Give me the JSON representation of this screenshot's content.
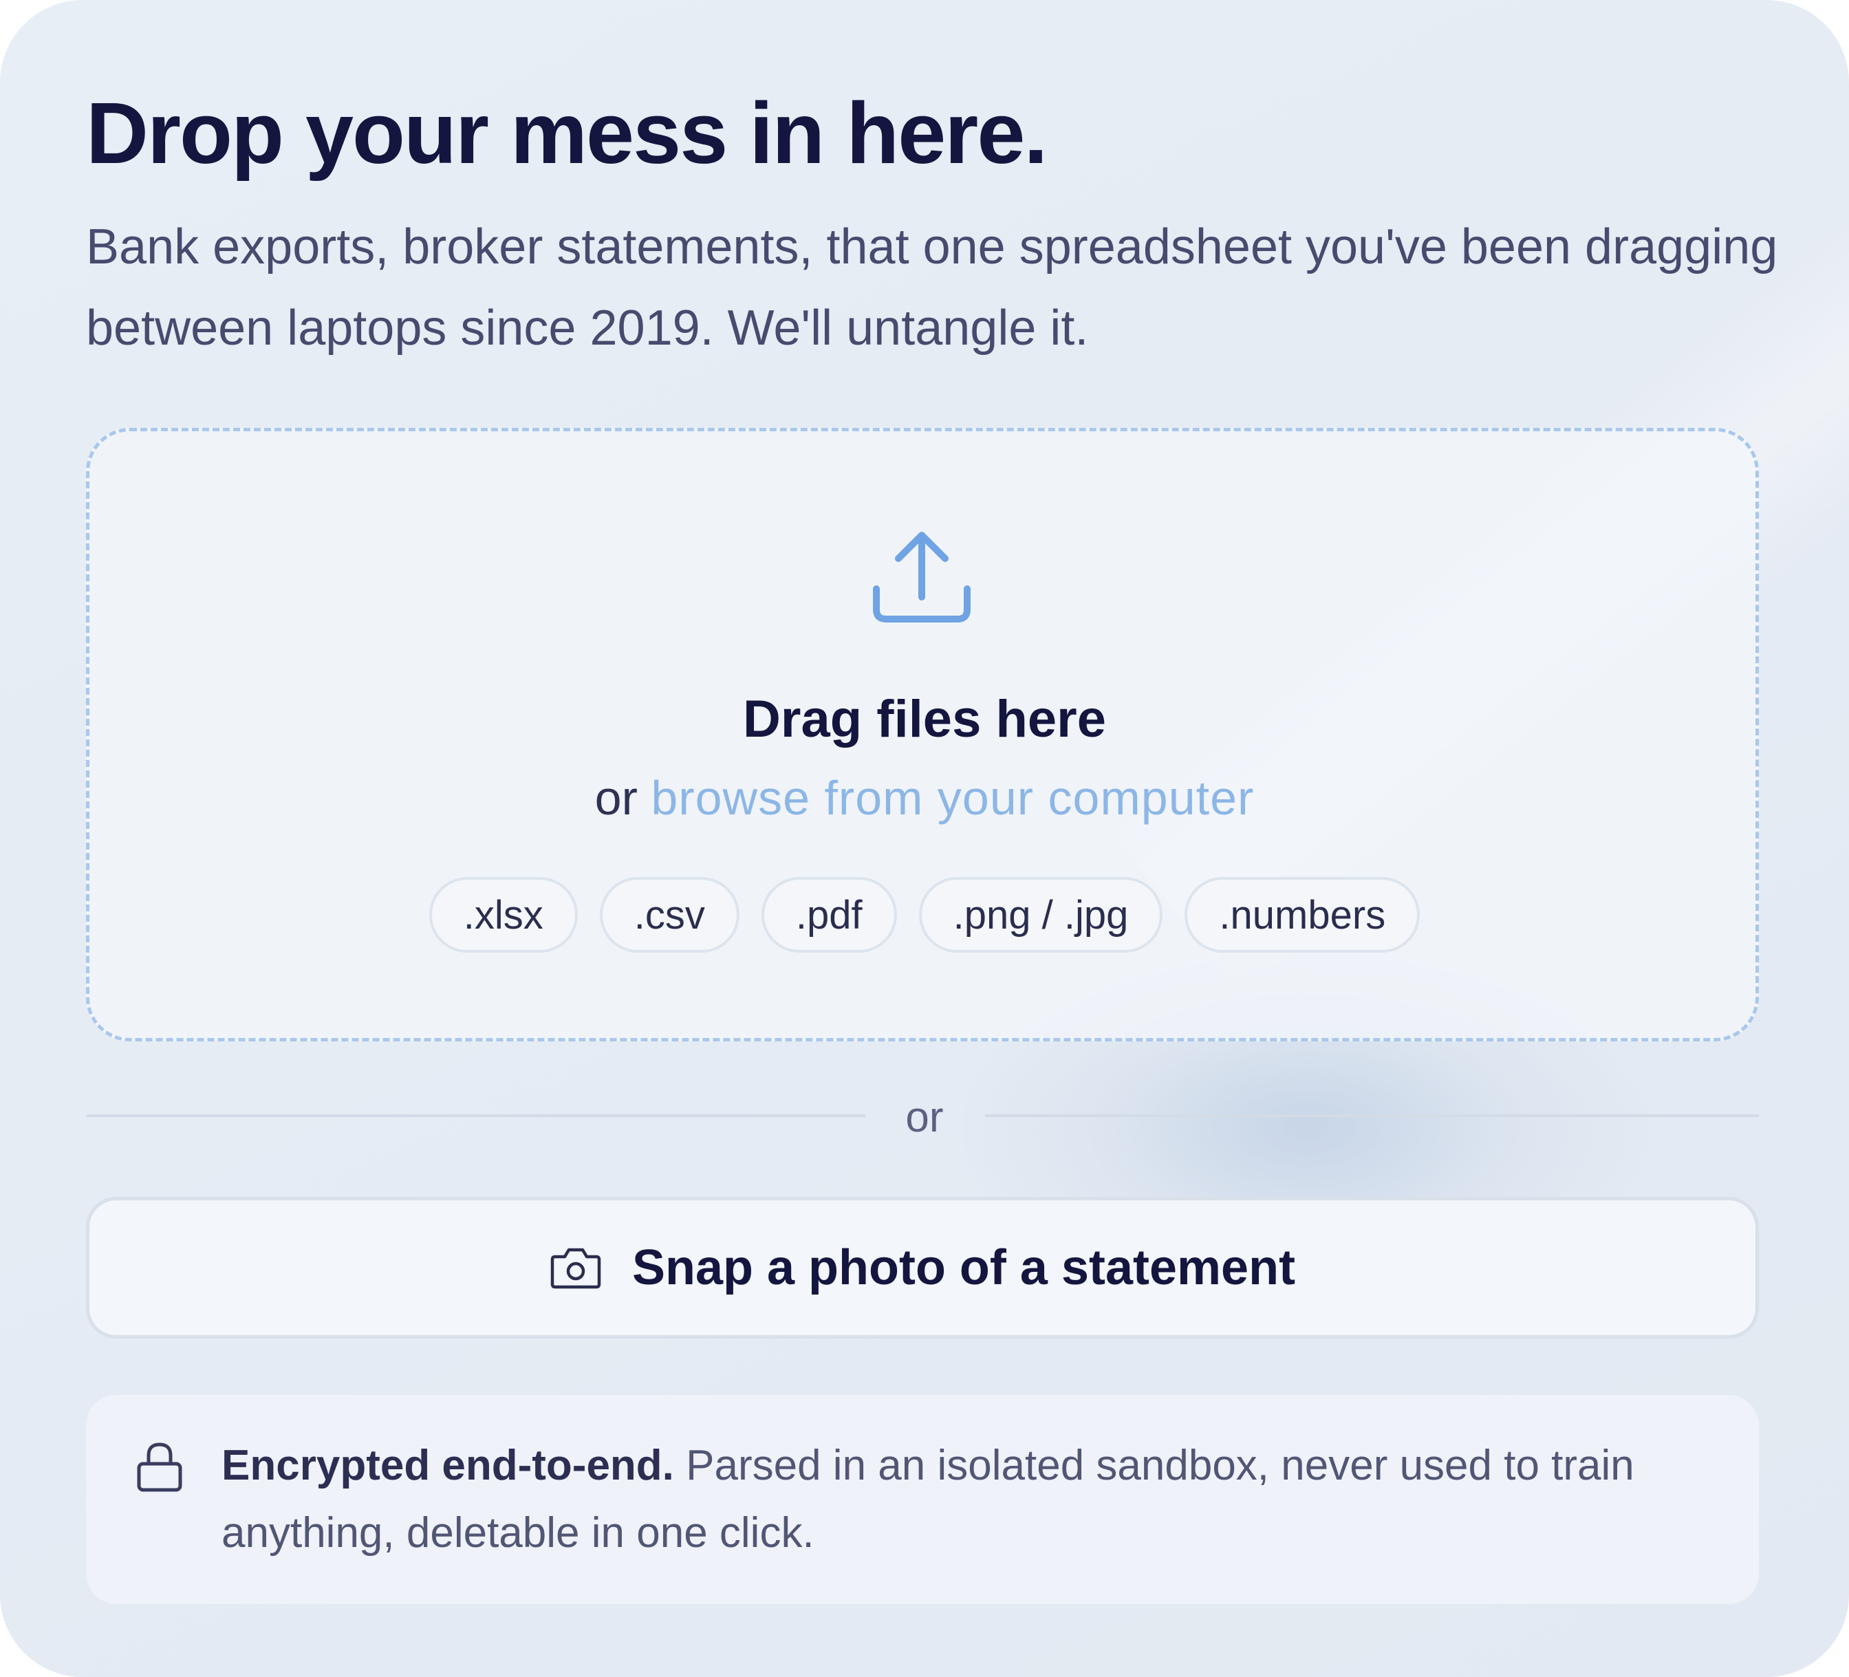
{
  "header": {
    "title": "Drop your mess in here.",
    "subtitle": "Bank exports, broker statements, that one spreadsheet you've been dragging between laptops since 2019. We'll untangle it."
  },
  "dropzone": {
    "icon": "upload-icon",
    "title": "Drag files here",
    "or_prefix": "or",
    "browse_label": "browse from your computer",
    "formats": [
      ".xlsx",
      ".csv",
      ".pdf",
      ".png / .jpg",
      ".numbers"
    ]
  },
  "divider": {
    "label": "or"
  },
  "snap": {
    "icon": "camera-icon",
    "label": "Snap a photo of a statement"
  },
  "security": {
    "icon": "lock-icon",
    "strong": "Encrypted end-to-end.",
    "text": " Parsed in an isolated sandbox, never used to train anything, deletable in one click."
  },
  "colors": {
    "title": "#14163f",
    "link": "#8cb6e6",
    "dashed_border": "#a9c8ec",
    "icon_blue": "#6fa3e3"
  }
}
